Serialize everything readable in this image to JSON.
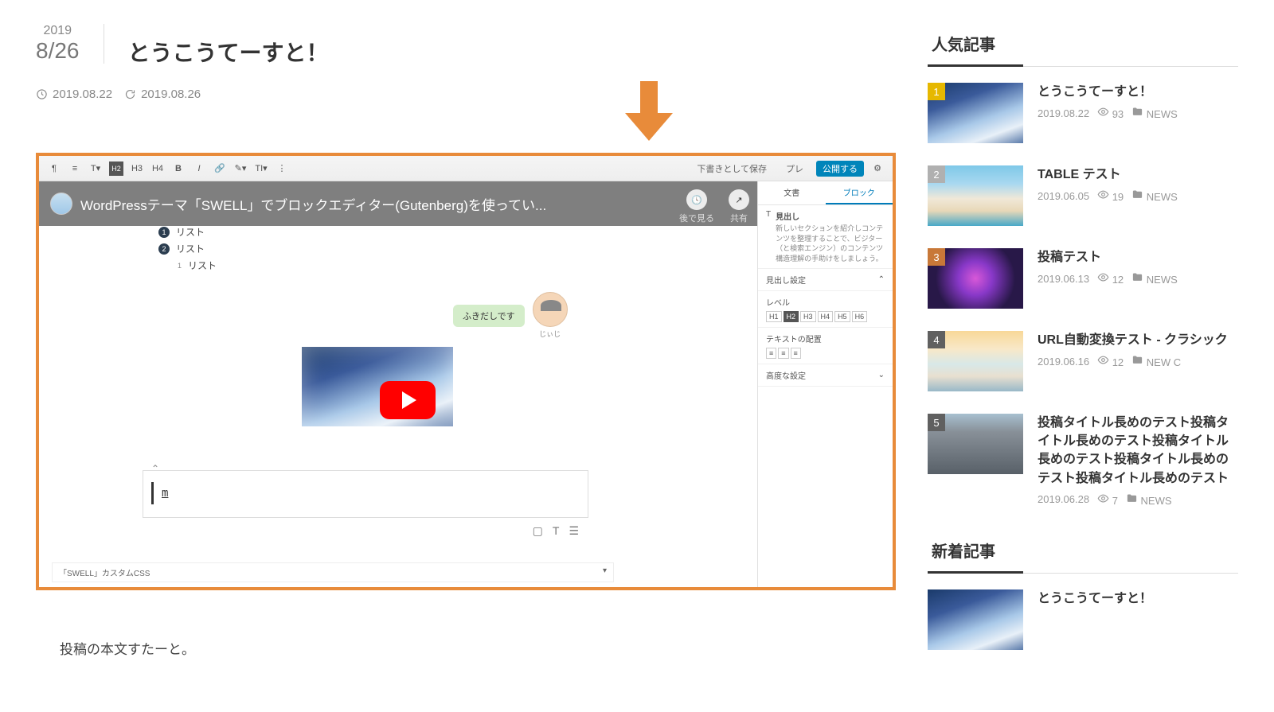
{
  "post": {
    "date_year": "2019",
    "date_md": "8/26",
    "title": "とうこうてーすと！",
    "published": "2019.08.22",
    "updated": "2019.08.26",
    "body_first": "投稿の本文すたーと。"
  },
  "youtube": {
    "title": "WordPressテーマ「SWELL」でブロックエディター(Gutenberg)を使ってい...",
    "watch_later": "後で見る",
    "share": "共有"
  },
  "editor": {
    "save_draft": "下書きとして保存",
    "preview": "プレ",
    "publish": "公開する",
    "list1": "リスト",
    "list2": "リスト",
    "list3": "リスト",
    "bubble": "ふきだしです",
    "face_name": "じぃじ",
    "input_char": "m",
    "custom_css": "「SWELL」カスタムCSS",
    "panel": {
      "tab_doc": "文書",
      "tab_block": "ブロック",
      "heading_label": "見出し",
      "heading_desc": "新しいセクションを紹介しコンテンツを整理することで、ビジター（と検索エンジン）のコンテンツ構造理解の手助けをしましょう。",
      "heading_settings": "見出し設定",
      "level": "レベル",
      "h1": "H1",
      "h2": "H2",
      "h3": "H3",
      "h4": "H4",
      "h5": "H5",
      "h6": "H6",
      "align": "テキストの配置",
      "advanced": "高度な設定"
    }
  },
  "sidebar": {
    "popular_title": "人気記事",
    "recent_title": "新着記事",
    "popular": [
      {
        "rank": "1",
        "title": "とうこうてーすと！",
        "date": "2019.08.22",
        "views": "93",
        "cat": "NEWS",
        "thumb": "th-clouds",
        "rankcolor": "#e6b800"
      },
      {
        "rank": "2",
        "title": "TABLE テスト",
        "date": "2019.06.05",
        "views": "19",
        "cat": "NEWS",
        "thumb": "th-beach",
        "rankcolor": "#b0b0b0"
      },
      {
        "rank": "3",
        "title": "投稿テスト",
        "date": "2019.06.13",
        "views": "12",
        "cat": "NEWS",
        "thumb": "th-laptop",
        "rankcolor": "#c87838"
      },
      {
        "rank": "4",
        "title": "URL自動変換テスト - クラシック",
        "date": "2019.06.16",
        "views": "12",
        "cat": "NEW C",
        "thumb": "th-beach2",
        "rankcolor": "#606060"
      },
      {
        "rank": "5",
        "title": "投稿タイトル長めのテスト投稿タイトル長めのテスト投稿タイトル長めのテスト投稿タイトル長めのテスト投稿タイトル長めのテスト",
        "date": "2019.06.28",
        "views": "7",
        "cat": "NEWS",
        "thumb": "th-city",
        "rankcolor": "#606060"
      }
    ],
    "recent": [
      {
        "title": "とうこうてーすと！",
        "thumb": "th-clouds"
      }
    ]
  }
}
